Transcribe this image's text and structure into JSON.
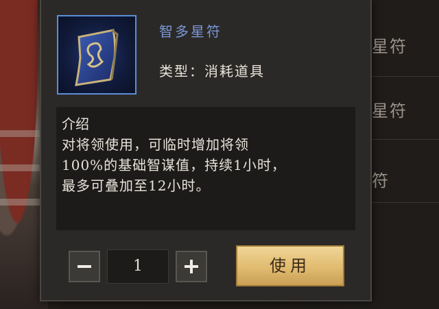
{
  "item": {
    "name": "智多星符",
    "type_text": "类型：消耗道具",
    "icon": "talisman-icon"
  },
  "description": {
    "title": "介绍",
    "text": "对将领使用，可临时增加将领\n100%的基础智谋值，持续1小时，\n最多可叠加至12小时。"
  },
  "quantity": {
    "value": "1",
    "minus_icon": "minus-icon",
    "plus_icon": "plus-icon"
  },
  "use_button_label": "使用",
  "background_list": {
    "rows": [
      "星符",
      "星符",
      "符"
    ]
  },
  "colors": {
    "item_name": "#7a98d8",
    "icon_border": "#5c8ed8",
    "use_button": "#e0bb70"
  }
}
